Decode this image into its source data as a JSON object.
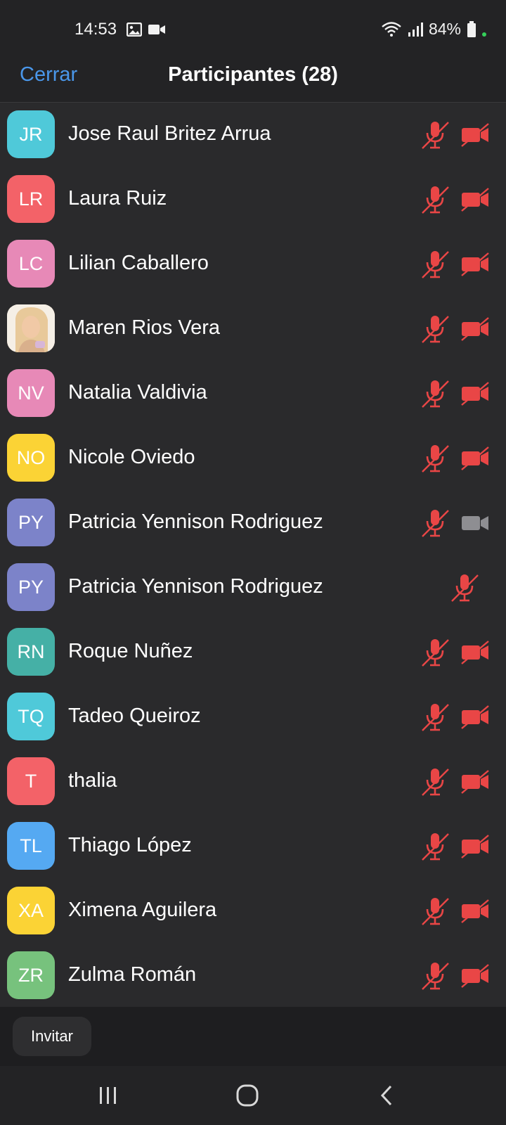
{
  "status_bar": {
    "time": "14:53",
    "battery": "84%",
    "icons": [
      "gallery-icon",
      "video-recording-icon",
      "wifi-icon",
      "signal-icon",
      "battery-icon"
    ]
  },
  "header": {
    "close_label": "Cerrar",
    "title": "Participantes (28)"
  },
  "colors": {
    "accent": "#4a97ea",
    "muted_red": "#e94646",
    "camera_on_gray": "#8e8e92"
  },
  "participants": [
    {
      "initials": "JR",
      "name": "Jose Raul Britez Arrua",
      "avatar_color": "#4fc9d9",
      "mic_muted": true,
      "video": "off"
    },
    {
      "initials": "LR",
      "name": "Laura Ruiz",
      "avatar_color": "#f36268",
      "mic_muted": true,
      "video": "off"
    },
    {
      "initials": "LC",
      "name": "Lilian Caballero",
      "avatar_color": "#e789b7",
      "mic_muted": true,
      "video": "off"
    },
    {
      "initials": "",
      "name": "Maren Rios Vera",
      "avatar_color": "#ffffff",
      "photo": true,
      "mic_muted": true,
      "video": "off"
    },
    {
      "initials": "NV",
      "name": "Natalia Valdivia",
      "avatar_color": "#e789b7",
      "mic_muted": true,
      "video": "off"
    },
    {
      "initials": "NO",
      "name": "Nicole Oviedo",
      "avatar_color": "#fbd335",
      "mic_muted": true,
      "video": "off"
    },
    {
      "initials": "PY",
      "name": "Patricia Yennison Rodriguez",
      "avatar_color": "#7c83c9",
      "mic_muted": true,
      "video": "on"
    },
    {
      "initials": "PY",
      "name": "Patricia Yennison Rodriguez",
      "avatar_color": "#7c83c9",
      "mic_muted": true,
      "video": "none"
    },
    {
      "initials": "RN",
      "name": "Roque Nuñez",
      "avatar_color": "#45b0a6",
      "mic_muted": true,
      "video": "off"
    },
    {
      "initials": "TQ",
      "name": "Tadeo Queiroz",
      "avatar_color": "#4fc9d9",
      "mic_muted": true,
      "video": "off"
    },
    {
      "initials": "T",
      "name": "thalia",
      "avatar_color": "#f36268",
      "mic_muted": true,
      "video": "off"
    },
    {
      "initials": "TL",
      "name": "Thiago López",
      "avatar_color": "#55a9f2",
      "mic_muted": true,
      "video": "off"
    },
    {
      "initials": "XA",
      "name": "Ximena Aguilera",
      "avatar_color": "#fbd335",
      "mic_muted": true,
      "video": "off"
    },
    {
      "initials": "ZR",
      "name": "Zulma Román",
      "avatar_color": "#77c27d",
      "mic_muted": true,
      "video": "off"
    }
  ],
  "footer": {
    "invite_label": "Invitar"
  },
  "navbar": {
    "buttons": [
      "recent-apps-icon",
      "home-icon",
      "back-icon"
    ]
  }
}
